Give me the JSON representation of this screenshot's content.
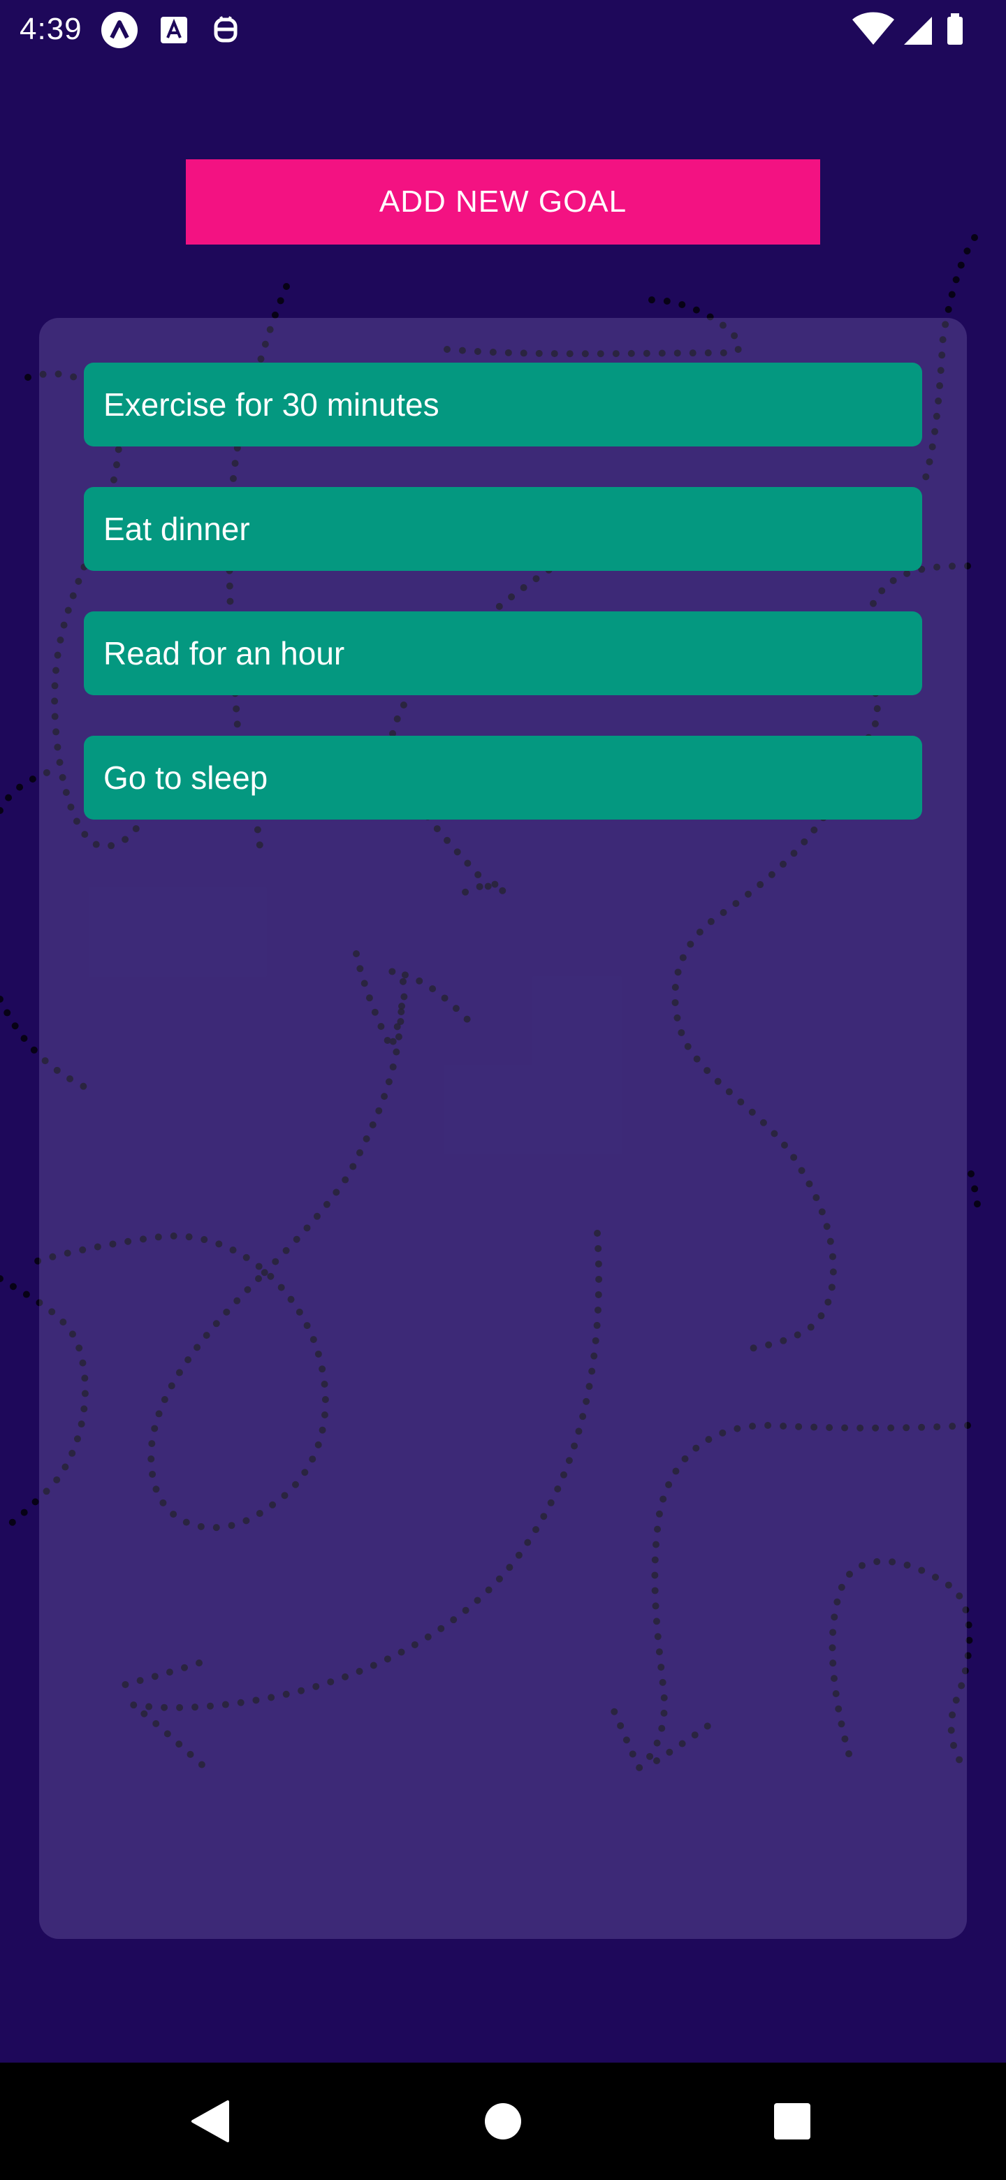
{
  "status_bar": {
    "time": "4:39",
    "left_icons": [
      "react-logo-icon",
      "font-app-icon",
      "robot-debug-icon"
    ],
    "right_icons": [
      "wifi-icon",
      "cellular-signal-icon",
      "battery-icon"
    ]
  },
  "actions": {
    "add_goal_label": "ADD NEW GOAL"
  },
  "goals": [
    {
      "text": "Exercise for 30 minutes"
    },
    {
      "text": "Eat dinner"
    },
    {
      "text": "Read for an hour"
    },
    {
      "text": "Go to sleep"
    }
  ],
  "nav_bar": {
    "buttons": [
      "back-icon",
      "home-icon",
      "recents-icon"
    ]
  },
  "colors": {
    "background": "#1e085a",
    "add_button": "#f31282",
    "goal_item": "#049880",
    "panel": "#3f2a72",
    "nav_bar": "#000000"
  }
}
